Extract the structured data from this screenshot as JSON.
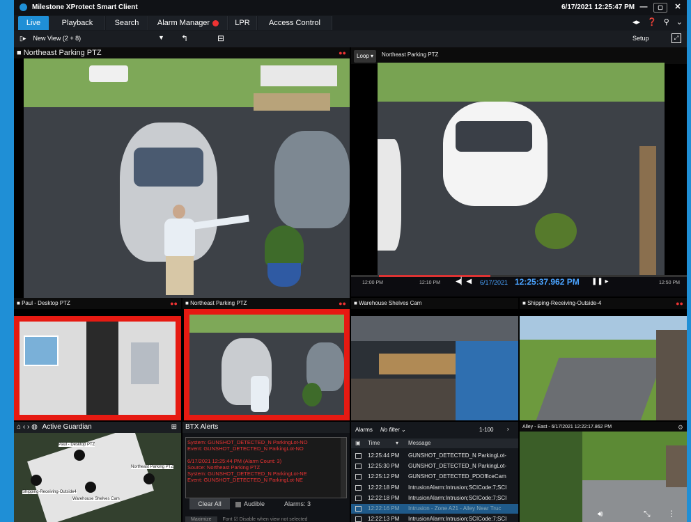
{
  "app": {
    "title": "Milestone XProtect Smart Client",
    "datetime": "6/17/2021 12:25:47 PM"
  },
  "tabs": [
    {
      "label": "Live"
    },
    {
      "label": "Playback"
    },
    {
      "label": "Search"
    },
    {
      "label": "Alarm Manager"
    },
    {
      "label": "LPR"
    },
    {
      "label": "Access Control"
    }
  ],
  "toolbar": {
    "view": "New View (2 + 8)",
    "setup": "Setup"
  },
  "cameras": {
    "main_left": "Northeast Parking PTZ",
    "main_right": "Northeast Parking PTZ",
    "loop": "Loop",
    "small1": "Paul - Desktop PTZ",
    "small2": "Northeast Parking PTZ",
    "small3": "Warehouse Shelves Cam",
    "small4": "Shipping-Receiving-Outside-4",
    "alley": "Alley - East - 6/17/2021 12:22:17.862 PM"
  },
  "playback": {
    "t1": "12:00 PM",
    "t2": "12:10 PM",
    "t3": "12:20 PM",
    "t4": "12:50 PM",
    "date": "6/17/2021",
    "time": "12:25:37.962 PM"
  },
  "guardian": {
    "title": "Active Guardian",
    "labels": [
      "Paul - Desktop PTZ",
      "Northeast Parking PTZ",
      "Shipping-Receiving-Outside4",
      "Warehouse Shelves Cam"
    ]
  },
  "btx": {
    "title": "BTX Alerts",
    "lines": [
      "System: GUNSHOT_DETECTED_N ParkingLot-NO",
      "Event: GUNSHOT_DETECTED_N ParkingLot-NO",
      "",
      "6/17/2021 12:25:44 PM (Alarm Count: 3)",
      "Source: Northeast Parking PTZ",
      "System: GUNSHOT_DETECTED_N ParkingLot-NE",
      "Event: GUNSHOT_DETECTED_N ParkingLot-NE"
    ],
    "clear": "Clear All",
    "audible": "Audible",
    "alarms": "Alarms: 3",
    "maximize": "Maximize",
    "font": "Font",
    "disable": "Disable when view not selected"
  },
  "alarms": {
    "title": "Alarms",
    "filter": "No filter",
    "range": "1-100",
    "col_time": "Time",
    "col_msg": "Message",
    "rows": [
      {
        "time": "12:25:44 PM",
        "msg": "GUNSHOT_DETECTED_N ParkingLot-"
      },
      {
        "time": "12:25:30 PM",
        "msg": "GUNSHOT_DETECTED_N ParkingLot-"
      },
      {
        "time": "12:25:12 PM",
        "msg": "GUNSHOT_DETECTED_PDOfficeCam"
      },
      {
        "time": "12:22:18 PM",
        "msg": "IntrusionAlarm:Intrusion;SCICode:7;SCI"
      },
      {
        "time": "12:22:18 PM",
        "msg": "IntrusionAlarm:Intrusion;SCICode:7;SCI"
      },
      {
        "time": "12:22:16 PM",
        "msg": "Intrusion - Zone A21 - Alley Near Truc"
      },
      {
        "time": "12:22:13 PM",
        "msg": "IntrusionAlarm:Intrusion;SCICode:7;SCI"
      }
    ]
  }
}
